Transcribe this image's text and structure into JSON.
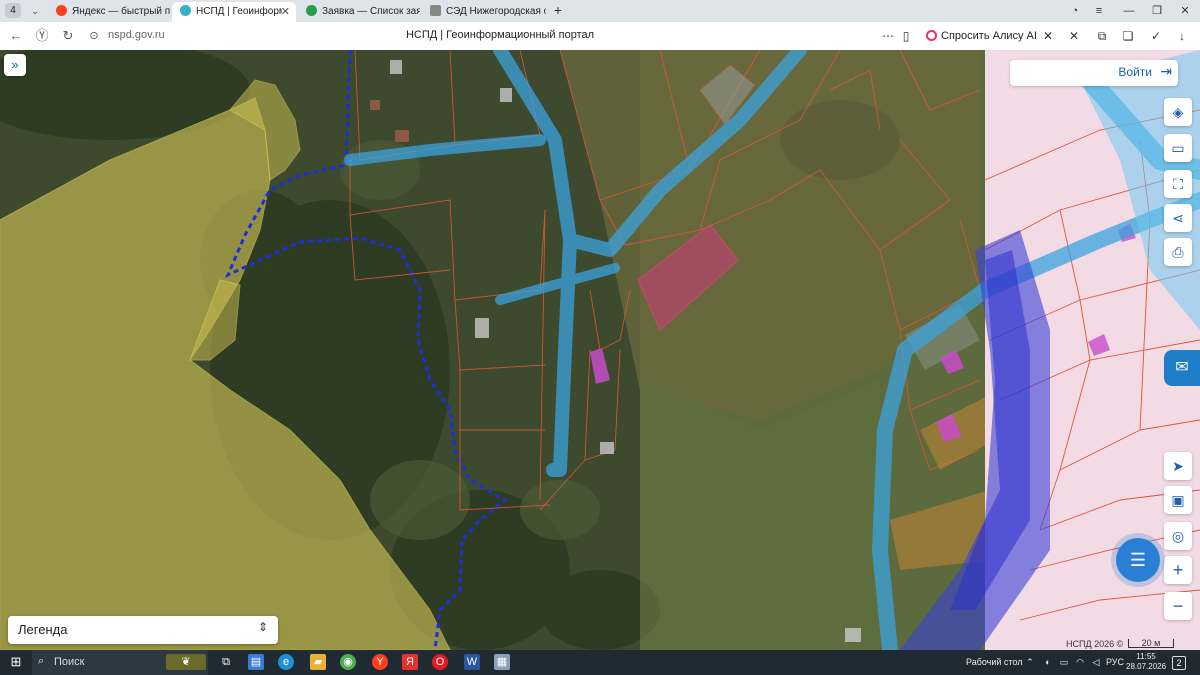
{
  "browser": {
    "tab_count": "4",
    "tabs": [
      {
        "label": "Яндекс — быстрый поиск",
        "color": "#fc3f1d"
      },
      {
        "label": "НСПД | Геоинформационный портал",
        "color": "#3ab0c8"
      },
      {
        "label": "Заявка — Список заявок",
        "color": "#2a9d4a"
      },
      {
        "label": "СЭД Нижегородская область",
        "color": "#888888"
      }
    ],
    "url": "nspd.gov.ru",
    "page_title": "НСПД | Геоинформационный портал",
    "alice_label": "Спросить Алису AI"
  },
  "map": {
    "login_label": "Войти",
    "legend_label": "Легенда",
    "attribution": "НСПД 2026 ©",
    "scale_label": "20 м",
    "tools": [
      "layers-icon",
      "ruler-icon",
      "select-area-icon",
      "share-icon",
      "print-icon"
    ],
    "bottom_tools": [
      "locate-icon",
      "basemap-icon",
      "geolocation-icon",
      "zoom-in-icon",
      "zoom-out-icon"
    ]
  },
  "taskbar": {
    "search_placeholder": "Поиск",
    "desktop_label": "Рабочий стол",
    "language": "РУС",
    "time": "11:55",
    "date": "28.07.2026",
    "notification_count": "2"
  }
}
